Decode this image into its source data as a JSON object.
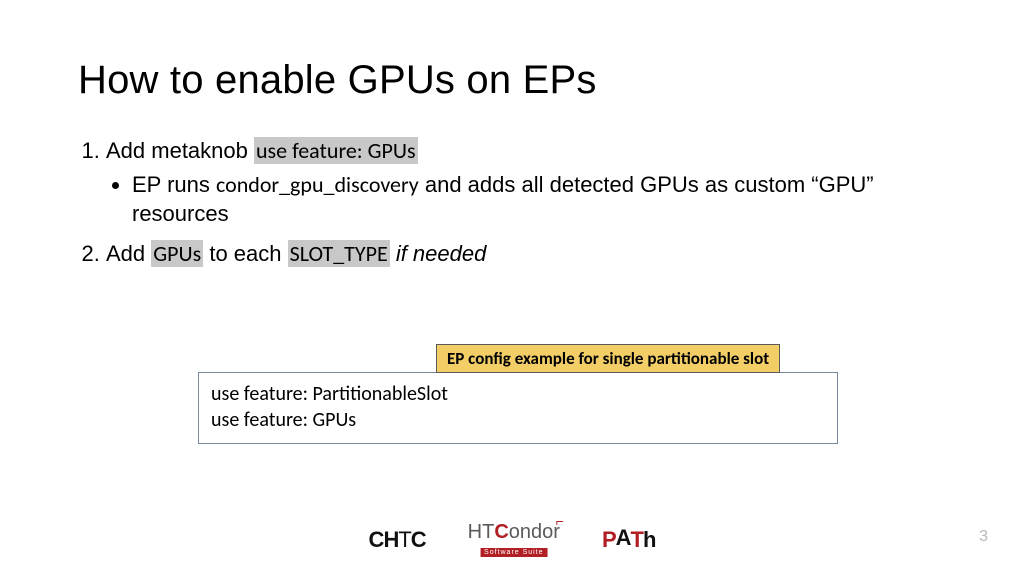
{
  "title": "How to enable GPUs on EPs",
  "list": {
    "item1_prefix": "Add metaknob ",
    "item1_code": "use feature: GPUs",
    "item1_sub_prefix": "EP runs ",
    "item1_sub_code": "condor_gpu_discovery",
    "item1_sub_suffix": " and adds all detected GPUs as custom “GPU” resources",
    "item2_prefix": "Add ",
    "item2_code1": "GPUs",
    "item2_mid": " to each ",
    "item2_code2": "SLOT_TYPE",
    "item2_suffix": " if needed"
  },
  "example": {
    "label": "EP config example for single partitionable slot",
    "line1": "use feature: PartitionableSlot",
    "line2": "use feature: GPUs"
  },
  "footer": {
    "page": "3"
  }
}
